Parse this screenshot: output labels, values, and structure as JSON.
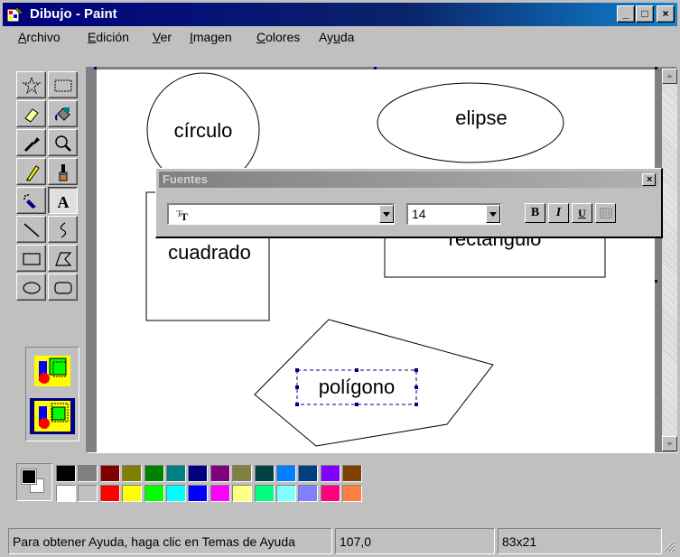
{
  "window": {
    "title": "Dibujo - Paint",
    "controls": {
      "minimize": "_",
      "maximize": "□",
      "close": "×"
    }
  },
  "menu": [
    {
      "label": "Archivo",
      "accel": "A",
      "rest": "rchivo"
    },
    {
      "label": "Edición",
      "accel": "E",
      "rest": "dición"
    },
    {
      "label": "Ver",
      "accel": "V",
      "rest": "er"
    },
    {
      "label": "Imagen",
      "accel": "I",
      "rest": "magen"
    },
    {
      "label": "Colores",
      "accel": "C",
      "rest": "olores"
    },
    {
      "label": "Ayuda",
      "pre": "Ay",
      "accel": "u",
      "rest": "da"
    }
  ],
  "toolbox": {
    "tools": [
      "free-form-select",
      "select",
      "eraser",
      "fill-with-color",
      "pick-color",
      "magnifier",
      "pencil",
      "brush",
      "airbrush",
      "text",
      "line",
      "curve",
      "rectangle",
      "polygon",
      "ellipse",
      "rounded-rectangle"
    ],
    "selected_tool": "text",
    "options": [
      "opaque-background",
      "transparent-background"
    ],
    "selected_option": "transparent-background"
  },
  "canvas": {
    "shapes": {
      "circle_label": "círculo",
      "ellipse_label": "elipse",
      "square_label": "cuadrado",
      "rectangle_label": "rectángulo",
      "polygon_label": "polígono"
    }
  },
  "fonts_toolbar": {
    "title": "Fuentes",
    "close": "×",
    "font_name": "",
    "font_size": "14",
    "bold": "B",
    "italic": "I",
    "underline": "U"
  },
  "palette": {
    "foreground": "#000000",
    "background": "#ffffff",
    "top_row": [
      "#000000",
      "#808080",
      "#800000",
      "#808000",
      "#008000",
      "#008080",
      "#000080",
      "#800080",
      "#808040",
      "#004040",
      "#0080ff",
      "#004080",
      "#8000ff",
      "#804000"
    ],
    "bottom_row": [
      "#ffffff",
      "#c0c0c0",
      "#ff0000",
      "#ffff00",
      "#00ff00",
      "#00ffff",
      "#0000ff",
      "#ff00ff",
      "#ffff80",
      "#00ff80",
      "#80ffff",
      "#8080ff",
      "#ff0080",
      "#ff8040"
    ]
  },
  "status": {
    "help": "Para obtener Ayuda, haga clic en Temas de Ayuda",
    "cursor_position": "107,0",
    "selection_size": "83x21"
  }
}
